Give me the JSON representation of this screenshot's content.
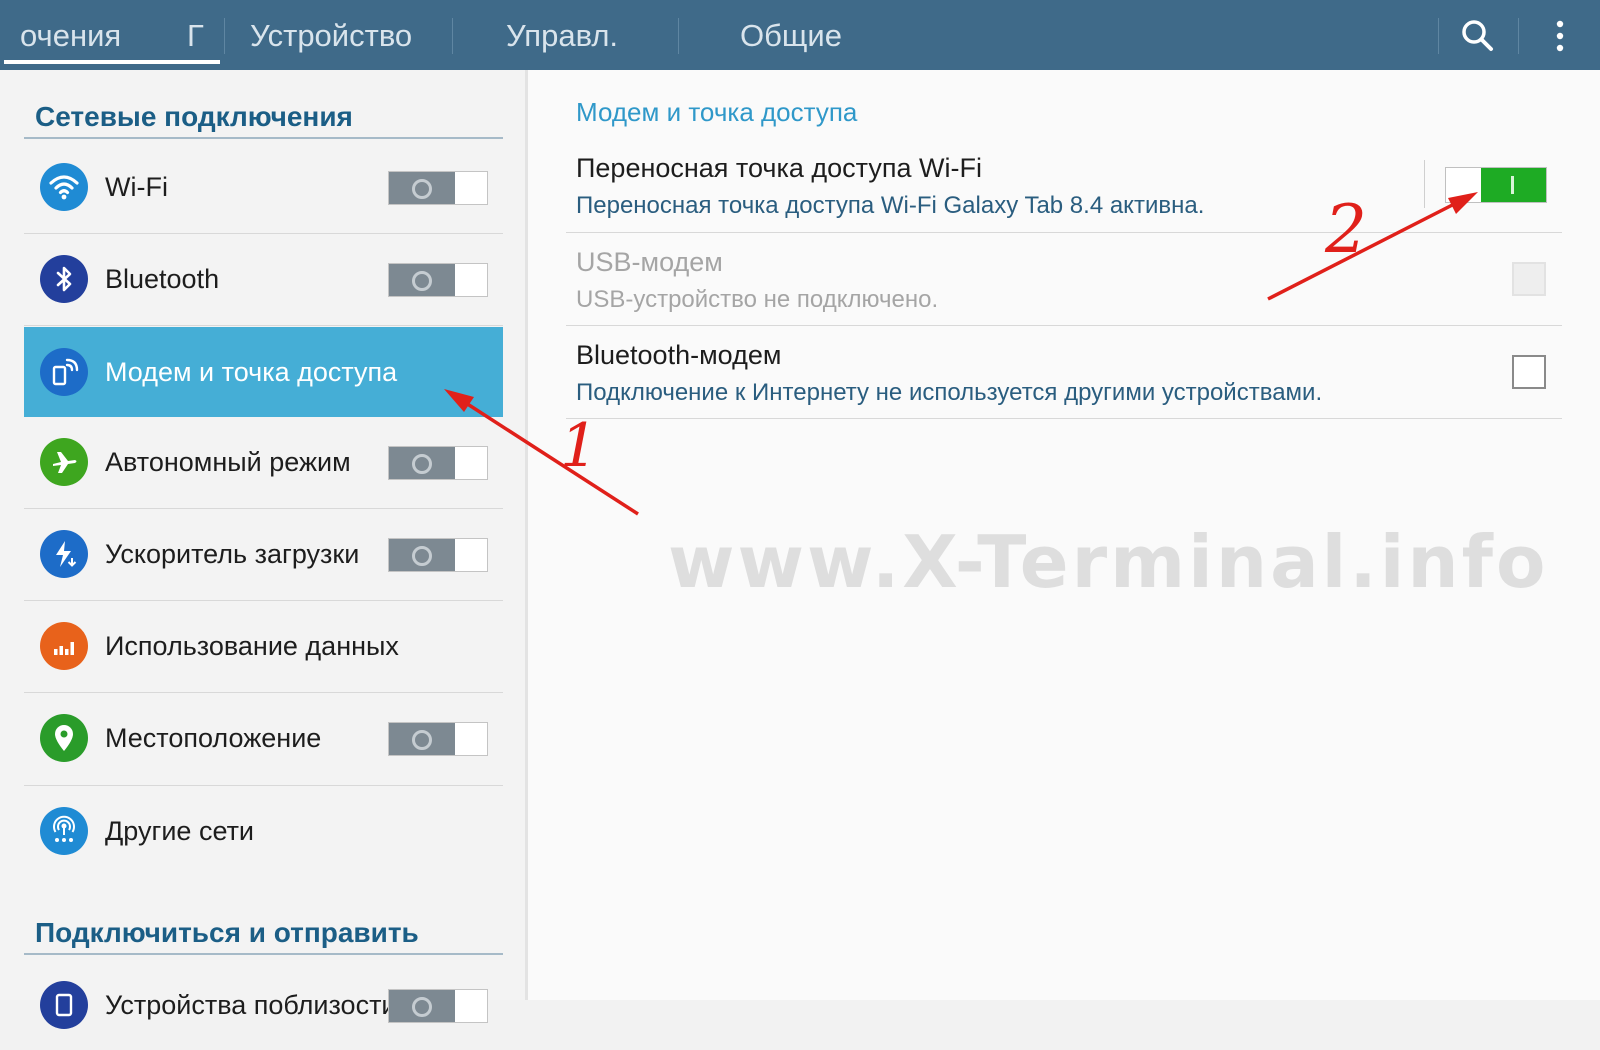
{
  "tabs": [
    {
      "label": "очения"
    },
    {
      "label": "Г"
    },
    {
      "label": "Устройство"
    },
    {
      "label": "Управл."
    },
    {
      "label": "Общие"
    }
  ],
  "colors": {
    "topbar": "#3f6a89",
    "accent": "#2f98c9",
    "selected": "#45aed6",
    "toggle_on": "#1eab24"
  },
  "icons": {
    "search": "search-icon",
    "menu": "overflow-menu-icon"
  },
  "sidebar": {
    "section1_title": "Сетевые подключения",
    "section2_title": "Подключиться и отправить",
    "items": [
      {
        "label": "Wi-Fi",
        "icon": "wifi-icon",
        "toggle": "off"
      },
      {
        "label": "Bluetooth",
        "icon": "bluetooth-icon",
        "toggle": "off"
      },
      {
        "label": "Модем и точка доступа",
        "icon": "hotspot-icon",
        "selected": true
      },
      {
        "label": "Автономный режим",
        "icon": "airplane-icon",
        "toggle": "off"
      },
      {
        "label": "Ускоритель загрузки",
        "icon": "download-booster-icon",
        "toggle": "off"
      },
      {
        "label": "Использование данных",
        "icon": "data-usage-icon"
      },
      {
        "label": "Местоположение",
        "icon": "location-icon",
        "toggle": "off"
      },
      {
        "label": "Другие сети",
        "icon": "other-networks-icon"
      },
      {
        "label": "Устройства поблизости",
        "icon": "nearby-devices-icon",
        "toggle": "off"
      }
    ]
  },
  "main": {
    "title": "Модем и точка доступа",
    "rows": [
      {
        "title": "Переносная точка доступа Wi-Fi",
        "subtitle": "Переносная точка доступа Wi-Fi Galaxy Tab 8.4 активна.",
        "control": "toggle-on"
      },
      {
        "title": "USB-модем",
        "subtitle": "USB-устройство не подключено.",
        "control": "checkbox-disabled"
      },
      {
        "title": "Bluetooth-модем",
        "subtitle": "Подключение к Интернету не используется другими устройствами.",
        "control": "checkbox-unchecked"
      }
    ]
  },
  "annotations": {
    "marker1": "1",
    "marker2": "2"
  },
  "watermark": "www.X-Terminal.info"
}
